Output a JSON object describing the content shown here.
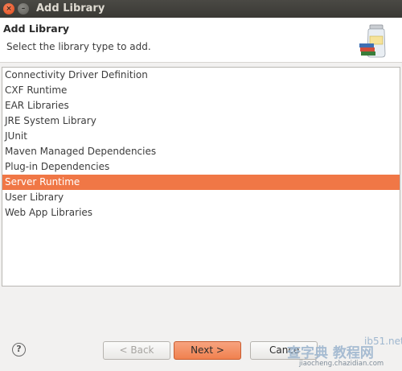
{
  "window": {
    "title": "Add Library",
    "close_glyph": "×",
    "min_glyph": "–"
  },
  "header": {
    "title": "Add Library",
    "description": "Select the library type to add.",
    "icon": "library-jar-icon"
  },
  "library_types": {
    "items": [
      {
        "label": "Connectivity Driver Definition"
      },
      {
        "label": "CXF Runtime"
      },
      {
        "label": "EAR Libraries"
      },
      {
        "label": "JRE System Library"
      },
      {
        "label": "JUnit"
      },
      {
        "label": "Maven Managed Dependencies"
      },
      {
        "label": "Plug-in Dependencies"
      },
      {
        "label": "Server Runtime"
      },
      {
        "label": "User Library"
      },
      {
        "label": "Web App Libraries"
      }
    ],
    "selected": "Server Runtime"
  },
  "buttons": {
    "help": "?",
    "back": "< Back",
    "next": "Next >",
    "cancel": "Cance"
  },
  "watermark": {
    "main": "查字典 教程网",
    "url": "ib51.net",
    "sub": "jiaocheng.chazidian.com"
  },
  "colors": {
    "selection": "#f07746",
    "titlebar": "#3c3b37"
  }
}
